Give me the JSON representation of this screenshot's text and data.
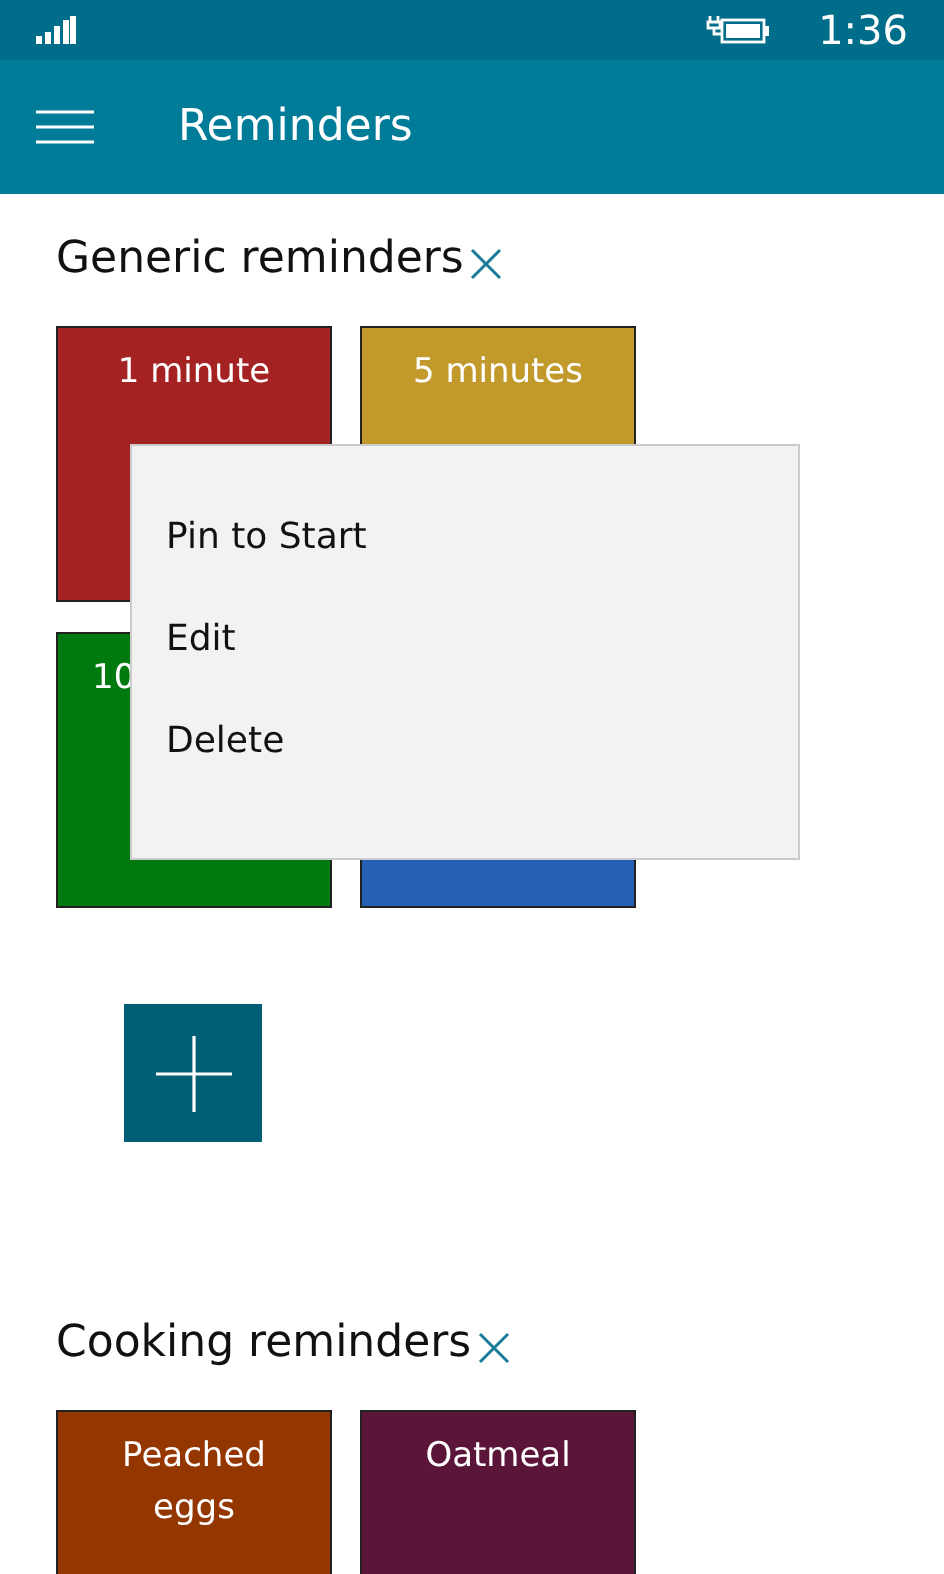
{
  "status_bar": {
    "time": "1:36"
  },
  "app_bar": {
    "title": "Reminders"
  },
  "groups": [
    {
      "title": "Generic reminders",
      "tiles": [
        {
          "label": "1 minute",
          "color": "#a52222",
          "kind": "full"
        },
        {
          "label": "5 minutes",
          "color": "#c19a2b",
          "kind": "full"
        },
        {
          "label": "10",
          "color": "#00790f",
          "kind": "covered"
        },
        {
          "color": "#2461b5",
          "kind": "covered"
        }
      ],
      "add_button": true
    },
    {
      "title": "Cooking reminders",
      "tiles": [
        {
          "label": "Peached eggs",
          "color": "#933600",
          "kind": "full"
        },
        {
          "label": "Oatmeal",
          "color": "#5b1539",
          "kind": "full"
        }
      ],
      "add_button": false
    }
  ],
  "context_menu": {
    "items": [
      "Pin to Start",
      "Edit",
      "Delete"
    ]
  }
}
